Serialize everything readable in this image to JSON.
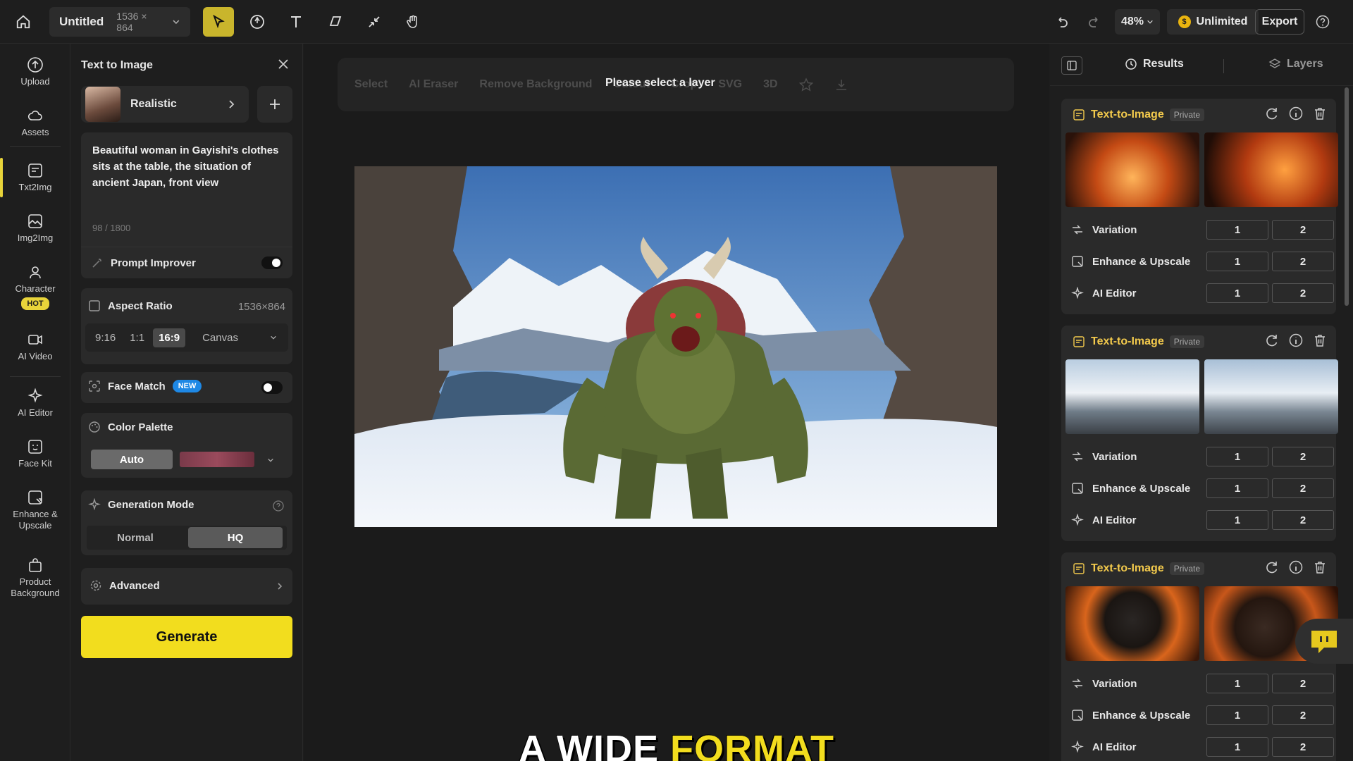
{
  "topbar": {
    "doc_title": "Untitled",
    "doc_size": "1536 × 864",
    "zoom": "48%",
    "plan": "Unlimited",
    "export": "Export"
  },
  "rail": [
    {
      "label": "Upload"
    },
    {
      "label": "Assets"
    },
    {
      "label": "Txt2Img"
    },
    {
      "label": "Img2Img"
    },
    {
      "label": "Character",
      "badge": "HOT"
    },
    {
      "label": "AI Video"
    },
    {
      "label": "AI Editor"
    },
    {
      "label": "Face Kit"
    },
    {
      "label": "Enhance & Upscale"
    },
    {
      "label": "Product Background"
    }
  ],
  "panel": {
    "title": "Text to Image",
    "model": "Realistic",
    "prompt": "Beautiful woman in Gayishi's clothes sits at the table, the situation of ancient Japan, front view",
    "counter": "98 / 1800",
    "prompt_improver": "Prompt Improver",
    "aspect_ratio": {
      "label": "Aspect Ratio",
      "value": "1536×864",
      "options": [
        "9:16",
        "1:1",
        "16:9"
      ],
      "selected": "16:9",
      "canvas": "Canvas"
    },
    "face_match": {
      "label": "Face Match",
      "badge": "NEW"
    },
    "color_palette": {
      "label": "Color Palette",
      "auto": "Auto",
      "swatch": "#7a3a4a"
    },
    "generation_mode": {
      "label": "Generation Mode",
      "options": [
        "Normal",
        "HQ"
      ],
      "selected": "HQ"
    },
    "advanced": "Advanced",
    "generate": "Generate"
  },
  "canvas": {
    "toolbar": [
      "Select",
      "AI Eraser",
      "Remove Background",
      "Cutout",
      "Crop",
      "SVG",
      "3D"
    ],
    "tooltip": "Please select a layer",
    "caption_white": "A WIDE",
    "caption_yellow": "FORMAT"
  },
  "right": {
    "tabs": [
      "Results",
      "Layers"
    ],
    "cards": [
      {
        "title": "Text-to-Image",
        "badge": "Private",
        "theme": "fire-city"
      },
      {
        "title": "Text-to-Image",
        "badge": "Private",
        "theme": "mountain-warrior"
      },
      {
        "title": "Text-to-Image",
        "badge": "Private",
        "theme": "fire-creature"
      }
    ],
    "rows": [
      "Variation",
      "Enhance & Upscale",
      "AI Editor"
    ],
    "row_values": [
      "1",
      "2"
    ]
  },
  "colors": {
    "accent": "#f2dd1e",
    "badge_blue": "#1e88e5",
    "result_title": "#f2c94c"
  }
}
